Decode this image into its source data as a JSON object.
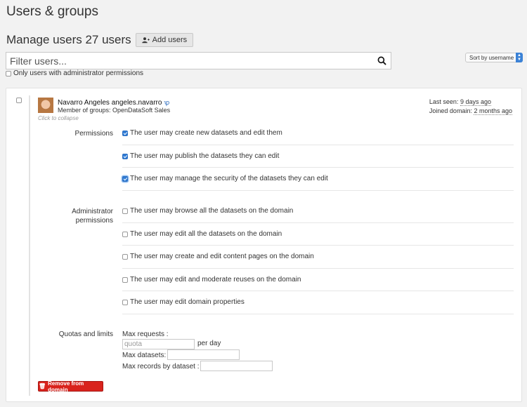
{
  "page": {
    "title": "Users & groups"
  },
  "manage": {
    "title": "Manage users 27 users",
    "add_label": "Add users"
  },
  "sort": {
    "selected": "Sort by username"
  },
  "search": {
    "placeholder": "Filter users..."
  },
  "filters": {
    "admin_only_label": "Only users with administrator permissions"
  },
  "user": {
    "name": "Navarro Angeles angeles.navarro",
    "groups": "Member of groups: OpenDataSoft Sales",
    "collapse_hint": "Click to collapse",
    "last_seen_label": "Last seen: ",
    "last_seen_value": "9 days ago",
    "joined_label": "Joined domain: ",
    "joined_value": "2 months ago"
  },
  "permissions": {
    "label": "Permissions",
    "items": [
      {
        "label": "The user may create new datasets and edit them",
        "checked": true
      },
      {
        "label": "The user may publish the datasets they can edit",
        "checked": true
      },
      {
        "label": "The user may manage the security of the datasets they can edit",
        "checked": true
      }
    ]
  },
  "admin_permissions": {
    "label_line1": "Administrator",
    "label_line2": "permissions",
    "items": [
      {
        "label": "The user may browse all the datasets on the domain",
        "checked": false
      },
      {
        "label": "The user may edit all the datasets on the domain",
        "checked": false
      },
      {
        "label": "The user may create and edit content pages on the domain",
        "checked": false
      },
      {
        "label": "The user may edit and moderate reuses on the domain",
        "checked": false
      },
      {
        "label": "The user may edit domain properties",
        "checked": false
      }
    ]
  },
  "quotas": {
    "label": "Quotas and limits",
    "max_requests_label": "Max requests :",
    "max_requests_placeholder": "quota",
    "per_day": "per day",
    "max_datasets_label": "Max datasets:",
    "max_records_label": "Max records by dataset :"
  },
  "remove_label": "Remove from domain",
  "colors": {
    "accent": "#2f7cd6",
    "danger": "#d9231d"
  }
}
